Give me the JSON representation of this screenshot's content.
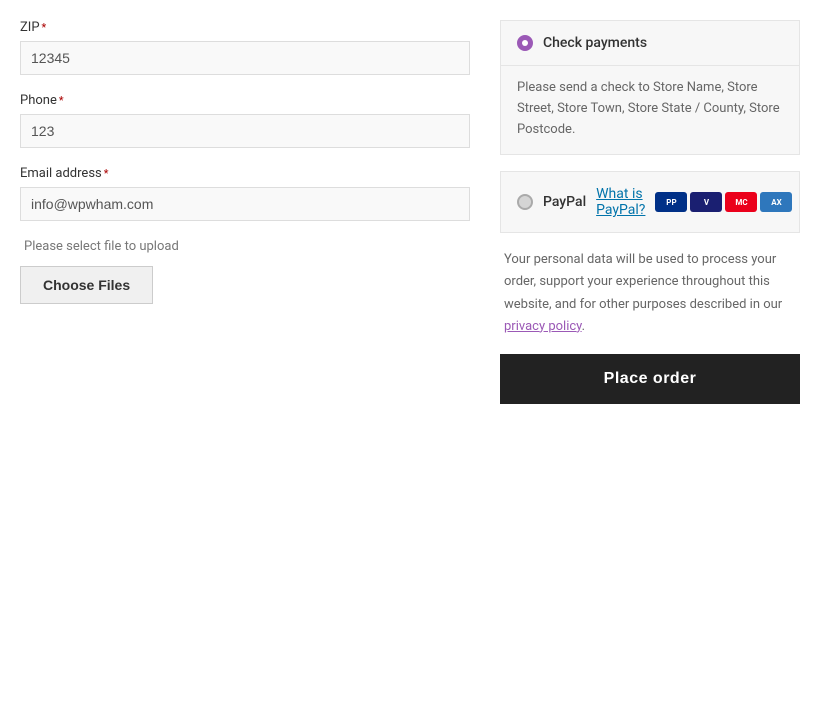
{
  "left": {
    "zip_label": "ZIP",
    "zip_required": "*",
    "zip_value": "12345",
    "phone_label": "Phone",
    "phone_required": "*",
    "phone_value": "123",
    "email_label": "Email address",
    "email_required": "*",
    "email_value": "info@wpwham.com",
    "file_hint": "Please select file to upload",
    "choose_files_label": "Choose Files"
  },
  "right": {
    "check_payments_label": "Check payments",
    "check_description": "Please send a check to Store Name, Store Street, Store Town, Store State / County, Store Postcode.",
    "paypal_label": "PayPal",
    "paypal_link_text": "What is PayPal?",
    "privacy_text_1": "Your personal data will be used to process your order, support your experience throughout this website, and for other purposes described in our ",
    "privacy_link_text": "privacy policy",
    "privacy_text_2": ".",
    "place_order_label": "Place order"
  }
}
